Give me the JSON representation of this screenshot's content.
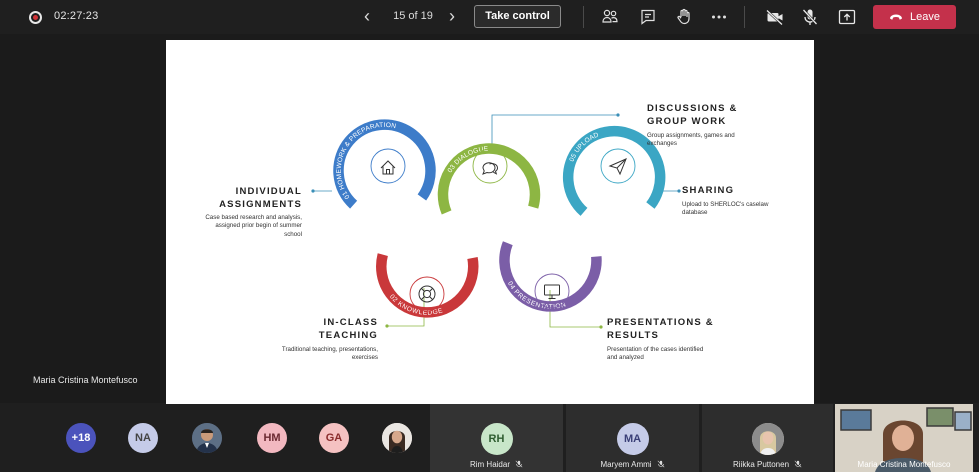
{
  "toolbar": {
    "timer": "02:27:23",
    "page_indicator": "15 of 19",
    "take_control_label": "Take control",
    "leave_label": "Leave",
    "colors": {
      "leave": "#c4314b",
      "record": "#d13438"
    }
  },
  "slide": {
    "arcs": [
      {
        "label": "01 HOMEWORK & PREPARATION",
        "color": "#3d7cc9",
        "icon": "home-icon"
      },
      {
        "label": "02 KNOWLEDGE",
        "color": "#c9383a",
        "icon": "lifebuoy-icon"
      },
      {
        "label": "03 DIALOGUE",
        "color": "#8db643",
        "icon": "chat-bubbles-icon"
      },
      {
        "label": "04 PRESENTATION",
        "color": "#7b5ea7",
        "icon": "monitor-icon"
      },
      {
        "label": "05 UPLOAD",
        "color": "#3ba6c4",
        "icon": "paper-plane-icon"
      }
    ],
    "individual": {
      "title_1": "INDIVIDUAL",
      "title_2": "ASSIGNMENTS",
      "desc_1": "Case based research and analysis,",
      "desc_2": "assigned prior begin of summer",
      "desc_3": "school"
    },
    "inclass": {
      "title_1": "IN-CLASS",
      "title_2": "TEACHING",
      "desc_1": "Traditional teaching, presentations,",
      "desc_2": "exercises"
    },
    "discussions": {
      "title_1": "DISCUSSIONS &",
      "title_2": "GROUP WORK",
      "desc_1": "Group assignments, games and",
      "desc_2": "exchanges"
    },
    "sharing": {
      "title_1": "SHARING",
      "desc_1": "Upload to SHERLOC's caselaw",
      "desc_2": "database"
    },
    "presentations": {
      "title_1": "PRESENTATIONS &",
      "title_2": "RESULTS",
      "desc_1": "Presentation of the cases identified",
      "desc_2": "and analyzed"
    }
  },
  "presenter_name": "Maria Cristina Montefusco",
  "participants": {
    "overflow_count": "+18",
    "avatars": [
      {
        "initials": "NA",
        "color": "#c5cbe8"
      },
      {
        "initials": "HM",
        "color": "#f2b8c0"
      },
      {
        "initials": "GA",
        "color": "#f5c2c2"
      }
    ],
    "tiles": [
      {
        "initials": "RH",
        "name": "Rim Haidar",
        "color": "#c8e6c9"
      },
      {
        "initials": "MA",
        "name": "Maryem Ammi",
        "color": "#c5cbe8"
      },
      {
        "name": "Riikka Puttonen"
      },
      {
        "name": "Maria Cristina Montefusco"
      }
    ]
  }
}
